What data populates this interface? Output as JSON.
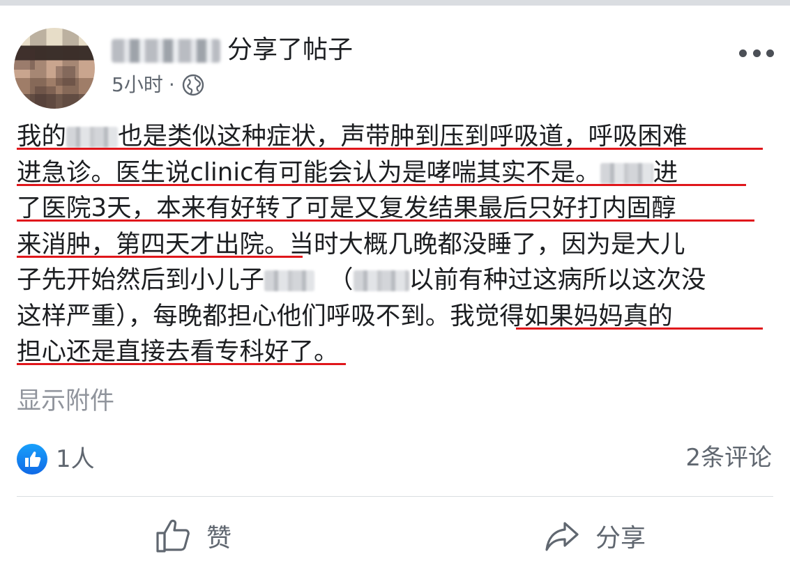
{
  "post": {
    "action": "分享了帖子",
    "time": "5小时",
    "separator": "·",
    "privacy_icon": "globe-icon",
    "more_icon": "more-options-icon",
    "lines": [
      [
        "我的",
        "也是类似这种症状，声带肿到压到呼吸道，呼吸困难"
      ],
      [
        "进急诊。医生说clinic有可能会认为是哮喘其实不是。",
        "进"
      ],
      [
        "了医院3天，本来有好转了可是又复发结果最后只好打内固醇"
      ],
      [
        "来消肿，第四天才出院。当时大概几晚都没睡了，因为是大儿"
      ],
      [
        "子先开始然后到小儿子",
        "（",
        "以前有种过这病所以这次没"
      ],
      [
        "这样严重），每晚都担心他们呼吸不到。我觉得如果妈妈真的"
      ],
      [
        "担心还是直接去看专科好了",
        "。"
      ]
    ],
    "show_attachments": "显示附件"
  },
  "reactions": {
    "like_count": "1人",
    "comment_count": "2条评论"
  },
  "actions": {
    "like": "赞",
    "share": "分享"
  },
  "colors": {
    "underline": "#e0161b",
    "like_blue": "#1877f2",
    "muted_text": "#606770"
  }
}
